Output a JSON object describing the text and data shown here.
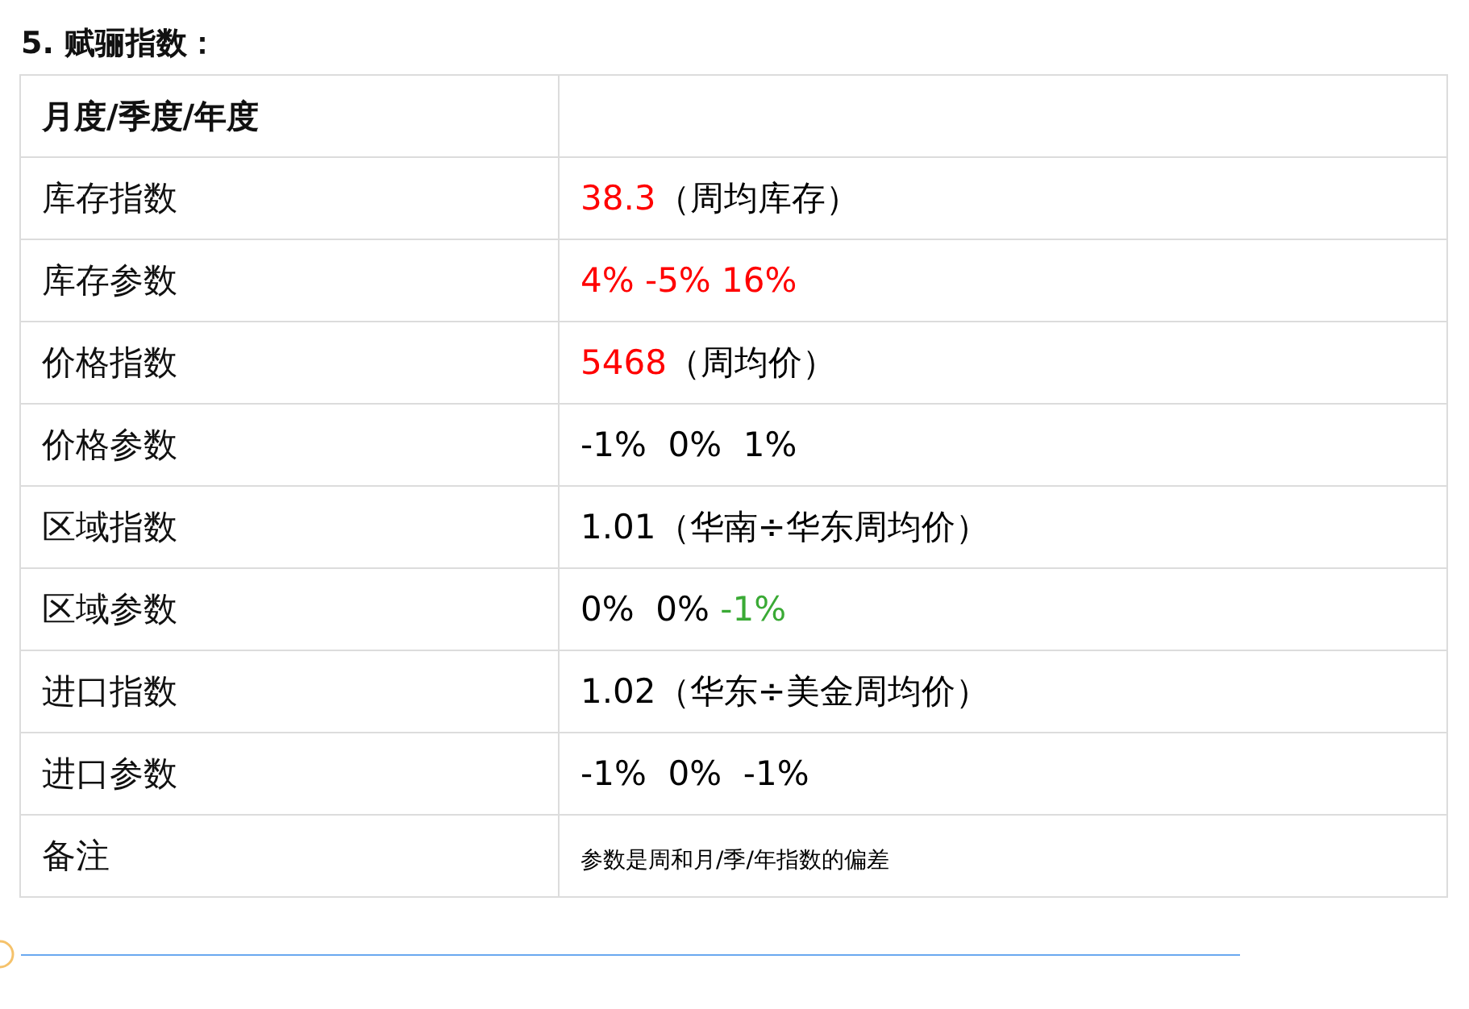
{
  "heading": "5. 赋骊指数：",
  "table": {
    "header": "月度/季度/年度",
    "rows": [
      {
        "label": "库存指数",
        "kind": "value",
        "segments": [
          {
            "text": "38.3",
            "color": "#ff0000"
          },
          {
            "text": "（周均库存）",
            "color": "#000000"
          }
        ]
      },
      {
        "label": "库存参数",
        "kind": "value",
        "segments": [
          {
            "text": "4% -5% 16%",
            "color": "#ff0000"
          }
        ]
      },
      {
        "label": "价格指数",
        "kind": "value",
        "segments": [
          {
            "text": "5468",
            "color": "#ff0000"
          },
          {
            "text": "（周均价）",
            "color": "#000000"
          }
        ]
      },
      {
        "label": "价格参数",
        "kind": "value",
        "segments": [
          {
            "text": "-1%  0%  1%",
            "color": "#000000"
          }
        ]
      },
      {
        "label": "区域指数",
        "kind": "value",
        "segments": [
          {
            "text": "1.01（华南÷华东周均价）",
            "color": "#000000"
          }
        ]
      },
      {
        "label": "区域参数",
        "kind": "value",
        "segments": [
          {
            "text": "0%  0% ",
            "color": "#000000"
          },
          {
            "text": "-1%",
            "color": "#3aaa35"
          }
        ]
      },
      {
        "label": "进口指数",
        "kind": "value",
        "segments": [
          {
            "text": "1.02（华东÷美金周均价）",
            "color": "#000000"
          }
        ]
      },
      {
        "label": "进口参数",
        "kind": "value",
        "segments": [
          {
            "text": "-1%  0%  -1%",
            "color": "#000000"
          }
        ]
      },
      {
        "label": "备注",
        "kind": "note",
        "segments": [
          {
            "text": "参数是周和月/季/年指数的偏差",
            "color": "#000000"
          }
        ]
      }
    ]
  }
}
